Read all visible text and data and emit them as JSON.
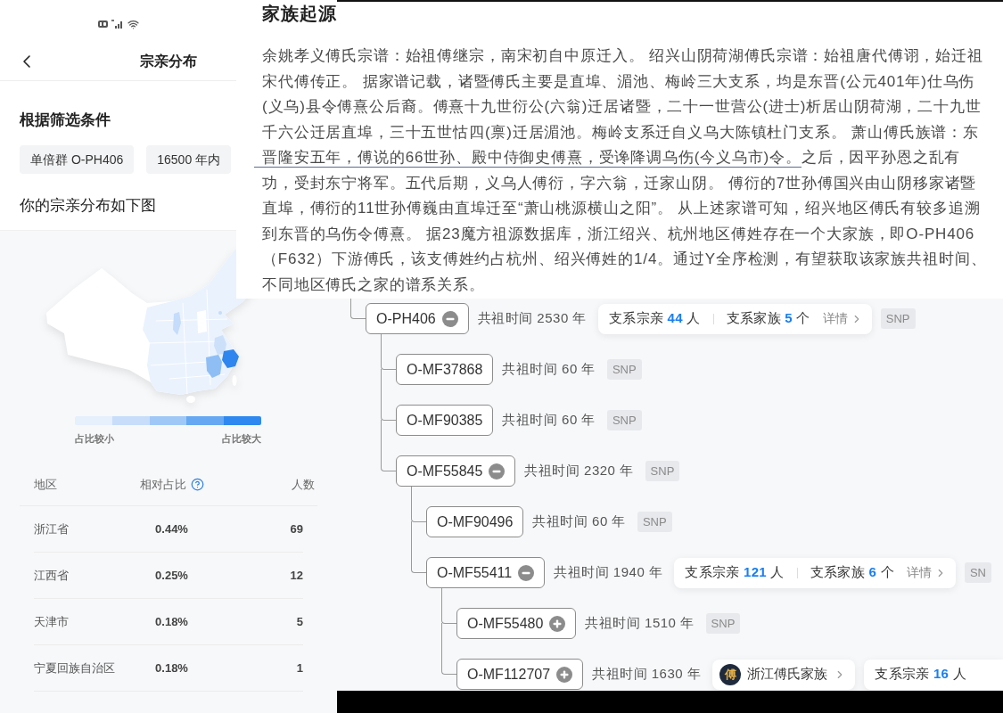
{
  "phone": {
    "header": {
      "title": "宗亲分布"
    },
    "filter": {
      "heading": "根据筛选条件",
      "chips": [
        "单倍群 O-PH406",
        "16500 年内"
      ]
    },
    "map_caption": "你的宗亲分布如下图",
    "legend": {
      "low": "占比较小",
      "high": "占比较大"
    },
    "table": {
      "columns": [
        "地区",
        "相对占比",
        "人数"
      ],
      "rows": [
        {
          "region": "浙江省",
          "ratio": "0.44%",
          "count": "69"
        },
        {
          "region": "江西省",
          "ratio": "0.25%",
          "count": "12"
        },
        {
          "region": "天津市",
          "ratio": "0.18%",
          "count": "5"
        },
        {
          "region": "宁夏回族自治区",
          "ratio": "0.18%",
          "count": "1"
        }
      ]
    }
  },
  "origin": {
    "title": "家族起源",
    "lines": [
      "余姚孝义傅氏宗谱：始祖傅继宗，南宋初自中原迁入。 绍兴山阴荷湖傅氏宗谱：始祖唐代傅诩，始迁祖",
      "宋代傅传正。 据家谱记载，诸暨傅氏主要是直埠、湄池、梅岭三大支系，均是东晋(公元401年)仕乌伤",
      "(义乌)县令傅熹公后裔。傅熹十九世衍公(六翁)迁居诸暨，二十一世营公(进士)析居山阴荷湖，二十九世",
      "千六公迁居直埠，三十五世怙四(禀)迁居湄池。梅岭支系迁自义乌大陈镇杜门支系。 萧山傅氏族谱：东",
      "晋隆安五年，傅说的66世孙、殿中侍御史傅熹，受谗降调乌伤(今义乌市)令。之后，因平孙恩之乱有",
      "功，受封东宁将军。五代后期，义乌人傅衍，字六翁，迁家山阴。 傅衍的7世孙傅国兴由山阴移家诸暨",
      "直埠，傅衍的11世孙傅巍由直埠迁至“萧山桃源横山之阳”。 从上述家谱可知，绍兴地区傅氏有较多追溯",
      "到东晋的乌伤令傅熹。 据23魔方祖源数据库，浙江绍兴、杭州地区傅姓存在一个大家族，即O-PH406",
      "（F632）下游傅氏，该支傅姓约占杭州、绍兴傅姓的1/4。通过Y全序检测，有望获取该家族共祖时间、",
      "不同地区傅氏之家的谱系关系。"
    ]
  },
  "tree": [
    {
      "label": "O-PH406",
      "expanded": true,
      "time": "共祖时间 2530 年",
      "stats": {
        "relatives": "支系宗亲 **44** 人",
        "families": "支系家族 **5** 个",
        "details": "详情"
      },
      "tag": "SNP",
      "children": [
        {
          "label": "O-MF37868",
          "time": "共祖时间 60 年",
          "tag": "SNP"
        },
        {
          "label": "O-MF90385",
          "time": "共祖时间 60 年",
          "tag": "SNP"
        },
        {
          "label": "O-MF55845",
          "expanded": true,
          "time": "共祖时间 2320 年",
          "tag": "SNP",
          "children": [
            {
              "label": "O-MF90496",
              "time": "共祖时间 60 年",
              "tag": "SNP"
            },
            {
              "label": "O-MF55411",
              "expanded": true,
              "time": "共祖时间 1940 年",
              "stats": {
                "relatives": "支系宗亲 **121** 人",
                "families": "支系家族 **6** 个",
                "details": "详情"
              },
              "tag": "SN",
              "children": [
                {
                  "label": "O-MF55480",
                  "expanded": false,
                  "time": "共祖时间 1510 年",
                  "tag": "SNP"
                },
                {
                  "label": "O-MF112707",
                  "expanded": false,
                  "time": "共祖时间 1630 年",
                  "family": {
                    "avatar": "傅",
                    "name": "浙江傅氏家族"
                  },
                  "stats": {
                    "relatives": "支系宗亲 **16** 人"
                  }
                }
              ]
            }
          ]
        }
      ]
    }
  ]
}
